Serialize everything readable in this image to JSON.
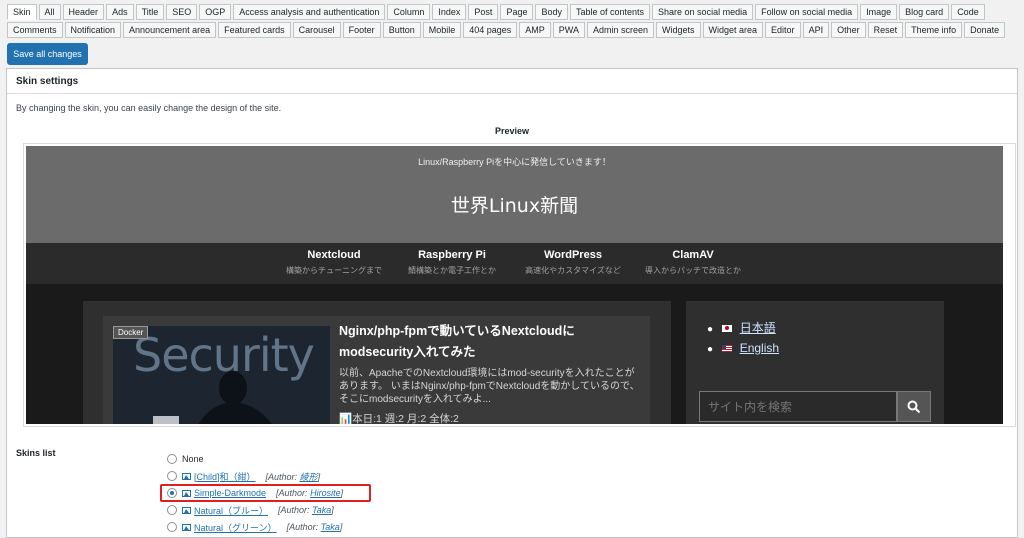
{
  "tabs_row1": [
    "Skin",
    "All",
    "Header",
    "Ads",
    "Title",
    "SEO",
    "OGP",
    "Access analysis and authentication",
    "Column",
    "Index",
    "Post",
    "Page",
    "Body",
    "Table of contents",
    "Share on social media",
    "Follow on social media",
    "Image",
    "Blog card",
    "Code"
  ],
  "tabs_row2": [
    "Comments",
    "Notification",
    "Announcement area",
    "Featured cards",
    "Carousel",
    "Footer",
    "Button",
    "Mobile",
    "404 pages",
    "AMP",
    "PWA",
    "Admin screen",
    "Widgets",
    "Widget area",
    "Editor",
    "API",
    "Other",
    "Reset",
    "Theme info",
    "Donate"
  ],
  "save_label": "Save all changes",
  "panel": {
    "title": "Skin settings",
    "description": "By changing the skin, you can easily change the design of the site.",
    "preview_label": "Preview"
  },
  "preview": {
    "tagline": "Linux/Raspberry Piを中心に発信していきます！",
    "site_title": "世界Linux新聞",
    "nav": [
      {
        "name": "Nextcloud",
        "sub": "構築からチューニングまで"
      },
      {
        "name": "Raspberry Pi",
        "sub": "鯖構築とか電子工作とか"
      },
      {
        "name": "WordPress",
        "sub": "高速化やカスタマイズなど"
      },
      {
        "name": "ClamAV",
        "sub": "導入からパッチで改造とか"
      }
    ],
    "post": {
      "badge": "Docker",
      "thumb_word": "Security",
      "title": "Nginx/php-fpmで動いているNextcloudにmodsecurity入れてみた",
      "snippet": "以前、ApacheでのNextcloud環境にはmod-securityを入れたことがあります。 いまはNginx/php-fpmでNextcloudを動かしているので、そこにmodsecurityを入れてみよ...",
      "stats": "本日:1  週:2  月:2  全体:2"
    },
    "languages": [
      "日本語",
      "English"
    ],
    "search_placeholder": "サイト内を検索",
    "colors": {
      "header_bg": "#6b6b6b",
      "nav_bg": "#2b2b2b",
      "body_bg": "#1a1a1a"
    }
  },
  "skins": {
    "label": "Skins list",
    "items": [
      {
        "name": "None",
        "checked": false
      },
      {
        "name": "[Child]和（紺）",
        "author_prefix": "[Author:",
        "author": "綾形",
        "author_suffix": "]",
        "checked": false
      },
      {
        "name": "Simple-Darkmode",
        "author_prefix": "[Author:",
        "author": "Hirosite",
        "author_suffix": "]",
        "checked": true
      },
      {
        "name": "Natural（ブルー）",
        "author_prefix": "[Author:",
        "author": "Taka",
        "author_suffix": "]",
        "checked": false
      },
      {
        "name": "Natural（グリーン）",
        "author_prefix": "[Author:",
        "author": "Taka",
        "author_suffix": "]",
        "checked": false
      }
    ]
  },
  "accent_color": "#2271b1",
  "highlight_color": "#e02020"
}
